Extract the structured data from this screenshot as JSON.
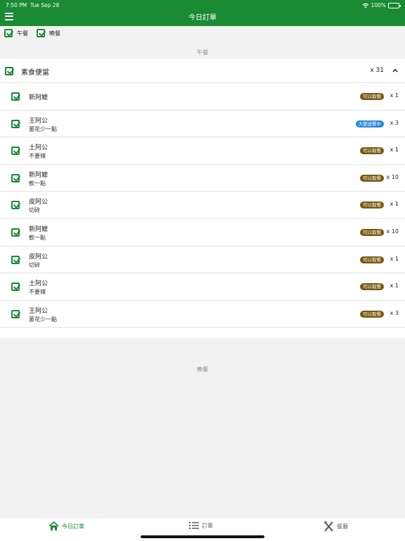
{
  "status": {
    "time": "7:50 PM",
    "date": "Tue Sep 28",
    "battery": "100%"
  },
  "header": {
    "title": "今日訂單"
  },
  "filters": [
    {
      "label": "午餐",
      "checked": true
    },
    {
      "label": "晚餐",
      "checked": true
    }
  ],
  "sections": {
    "lunch": "午餐",
    "dinner": "晚餐"
  },
  "group": {
    "name": "素食便當",
    "qty": "x 31"
  },
  "orders": [
    {
      "name": "新阿嬤",
      "note": "",
      "status": "可以取餐",
      "qty": "x 1"
    },
    {
      "name": "王阿公",
      "note": "蔥花少一點",
      "status": "大使送餐中",
      "qty": "x 3"
    },
    {
      "name": "土阿公",
      "note": "不要辣",
      "status": "可以取餐",
      "qty": "x 1"
    },
    {
      "name": "新阿嬤",
      "note": "軟一點",
      "status": "可以取餐",
      "qty": "x 10"
    },
    {
      "name": "皮阿公",
      "note": "切碎",
      "status": "可以取餐",
      "qty": "x 1"
    },
    {
      "name": "新阿嬤",
      "note": "軟一點",
      "status": "可以取餐",
      "qty": "x 10"
    },
    {
      "name": "皮阿公",
      "note": "切碎",
      "status": "可以取餐",
      "qty": "x 1"
    },
    {
      "name": "土阿公",
      "note": "不要辣",
      "status": "可以取餐",
      "qty": "x 1"
    },
    {
      "name": "王阿公",
      "note": "蔥花少一點",
      "status": "可以取餐",
      "qty": "x 3"
    }
  ],
  "tabs": [
    {
      "label": "今日訂單",
      "icon": "home-icon",
      "active": true
    },
    {
      "label": "訂單",
      "icon": "list-icon",
      "active": false
    },
    {
      "label": "餐廳",
      "icon": "utensils-icon",
      "active": false
    }
  ],
  "colors": {
    "primary": "#1a8a33",
    "badge_ready": "#7a5a12",
    "badge_delivering": "#2a8ad8"
  }
}
